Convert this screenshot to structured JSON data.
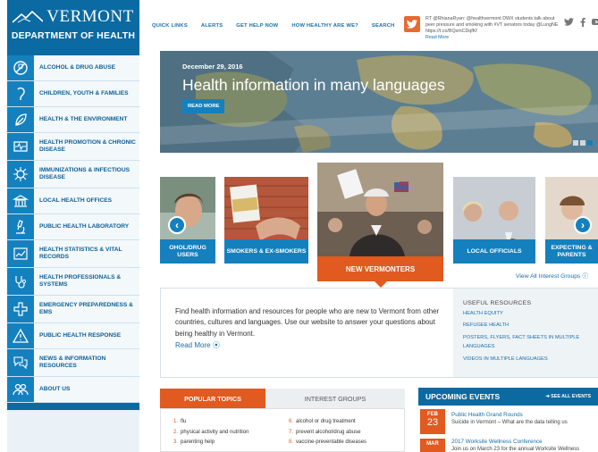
{
  "brand": {
    "line1": "VERMONT",
    "line2": "DEPARTMENT OF HEALTH"
  },
  "sidebar": {
    "items": [
      {
        "label": "ALCOHOL & DRUG ABUSE",
        "icon": "no-alcohol-icon"
      },
      {
        "label": "CHILDREN, YOUTH & FAMILIES",
        "icon": "pacifier-icon"
      },
      {
        "label": "HEALTH & THE ENVIRONMENT",
        "icon": "leaf-icon"
      },
      {
        "label": "HEALTH PROMOTION & CHRONIC DISEASE",
        "icon": "heartbeat-monitor-icon"
      },
      {
        "label": "IMMUNIZATIONS & INFECTIOUS DISEASE",
        "icon": "virus-icon"
      },
      {
        "label": "LOCAL HEALTH OFFICES",
        "icon": "building-icon"
      },
      {
        "label": "PUBLIC HEALTH LABORATORY",
        "icon": "microscope-icon"
      },
      {
        "label": "HEALTH STATISTICS & VITAL RECORDS",
        "icon": "chart-icon"
      },
      {
        "label": "HEALTH PROFESSIONALS & SYSTEMS",
        "icon": "stethoscope-icon"
      },
      {
        "label": "EMERGENCY PREPAREDNESS & EMS",
        "icon": "medical-cross-icon"
      },
      {
        "label": "PUBLIC HEALTH RESPONSE",
        "icon": "warning-icon"
      },
      {
        "label": "NEWS & INFORMATION RESOURCES",
        "icon": "chat-bubbles-icon"
      },
      {
        "label": "ABOUT US",
        "icon": "people-icon"
      }
    ]
  },
  "topnav": [
    "QUICK LINKS",
    "ALERTS",
    "GET HELP NOW",
    "HOW HEALTHY ARE WE?",
    "SEARCH"
  ],
  "tweet": {
    "text": "RT @RhianaRyan: @healthvermont DWX students talk about peer pressure and smoking with #VT senators today @LungNE https://t.co/BQsmCDqfKf",
    "more": "Read More"
  },
  "hero": {
    "date": "December 29, 2016",
    "title": "Health information in many languages",
    "button": "READ MORE"
  },
  "carousel": {
    "cards": [
      "OHOL/DRUG USERS",
      "SMOKERS & EX-SMOKERS",
      "NEW VERMONTERS",
      "LOCAL OFFICIALS",
      "EXPECTING & PARENTS"
    ],
    "view_all": "View All Interest Groups"
  },
  "info": {
    "description": "Find health information and resources for people who are new to Vermont from other countries, cultures and languages. Use our website to answer your questions about being healthy in Vermont.",
    "read_more": "Read More",
    "resources_title": "USEFUL RESOURCES",
    "resources": [
      "HEALTH EQUITY",
      "REFUGEE HEALTH",
      "POSTERS, FLYERS, FACT SHEETS IN MULTIPLE LANGUAGES",
      "VIDEOS IN MULTIPLE LANGUAGES"
    ]
  },
  "topics": {
    "tab_active": "POPULAR TOPICS",
    "tab_inactive": "INTEREST GROUPS",
    "left": [
      {
        "n": "1.",
        "t": "flu"
      },
      {
        "n": "2.",
        "t": "physical activity and nutrition"
      },
      {
        "n": "3.",
        "t": "parenting help"
      }
    ],
    "right": [
      {
        "n": "6.",
        "t": "alcohol or drug treatment"
      },
      {
        "n": "7.",
        "t": "prevent alcohol/drug abuse"
      },
      {
        "n": "8.",
        "t": "vaccine-preventable diseases"
      }
    ]
  },
  "events": {
    "title": "UPCOMING EVENTS",
    "see_all": "SEE ALL EVENTS",
    "items": [
      {
        "month": "FEB",
        "day": "23",
        "title": "Public Health Grand Rounds",
        "sub": "Suicide in Vermont – What are the data telling us"
      },
      {
        "month": "MAR",
        "day": "",
        "title": "2017 Worksite Wellness Conference",
        "sub": "Join us on March 23 for the annual Worksite Wellness"
      }
    ]
  },
  "colors": {
    "primary": "#1580be",
    "dark_blue": "#0b6aa2",
    "accent": "#e15a1f"
  }
}
